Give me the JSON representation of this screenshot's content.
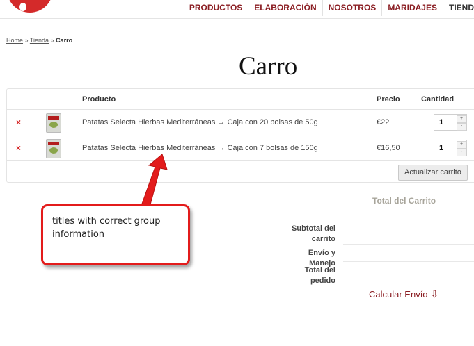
{
  "nav": {
    "items": [
      "PRODUCTOS",
      "ELABORACIÓN",
      "NOSOTROS",
      "MARIDAJES",
      "TIEND"
    ]
  },
  "breadcrumb": {
    "home": "Home",
    "sep1": " » ",
    "tienda": "Tienda",
    "sep2": " » ",
    "current": "Carro"
  },
  "page": {
    "title": "Carro"
  },
  "cart": {
    "headers": {
      "product": "Producto",
      "price": "Precio",
      "quantity": "Cantidad"
    },
    "items": [
      {
        "remove": "×",
        "name": "Patatas Selecta Hierbas Mediterráneas → Caja con 20 bolsas de 50g",
        "price": "€22",
        "qty": "1"
      },
      {
        "remove": "×",
        "name": "Patatas Selecta Hierbas Mediterráneas → Caja con 7 bolsas de 150g",
        "price": "€16,50",
        "qty": "1"
      }
    ],
    "update_label": "Actualizar carrito"
  },
  "totals": {
    "title": "Total del Carrito",
    "subtotal_label": "Subtotal del carrito",
    "shipping_label": "Envío y Manejo",
    "total_label": "Total del pedido",
    "calc_label": "Calcular Envío"
  },
  "annotation": {
    "text": "titles with correct group information",
    "color": "#e31b1b"
  },
  "colors": {
    "brand": "#8a1d22",
    "logo": "#d42a2a",
    "remove": "#d41c1c"
  }
}
